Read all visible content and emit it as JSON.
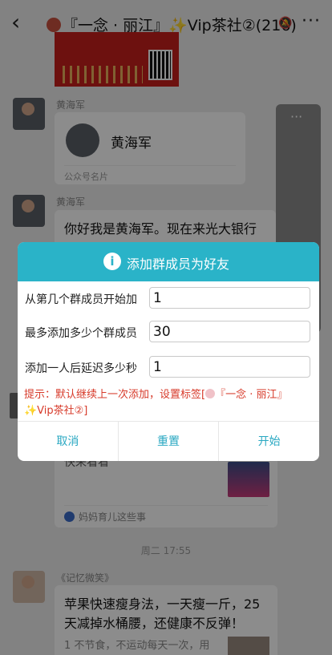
{
  "chat": {
    "back_glyph": "‹",
    "title": "『一念 · 丽江』✨Vip茶社②(216)",
    "mute_glyph": "🔕",
    "more_glyph": "···"
  },
  "messages": {
    "sender1": "黄海军",
    "card_name": "黄海军",
    "card_type": "公众号名片",
    "sender2": "黄海军",
    "bubble_text": "你好我是黄海军。现在来光大银行",
    "panel_dots": "···",
    "card2_text": "快来看看",
    "card2_source": "妈妈育儿这些事",
    "time": "周二 17:55",
    "sender3": "《记忆微笑》",
    "article_title": "苹果快速瘦身法，一天瘦一斤，25天减掉水桶腰，还健康不反弹！",
    "article_snippet": "1 不节食，不运动每天一次，用"
  },
  "dialog": {
    "icon": "i",
    "title": "添加群成员为好友",
    "fields": [
      {
        "label": "从第几个群成员开始加",
        "value": "1"
      },
      {
        "label": "最多添加多少个群成员",
        "value": "30"
      },
      {
        "label": "添加一人后延迟多少秒",
        "value": "1"
      }
    ],
    "tip_prefix": "提示：默认继续上一次添加，设置标签[",
    "tip_suffix": "『一念 · 丽江』✨Vip茶社②]",
    "buttons": {
      "cancel": "取消",
      "reset": "重置",
      "start": "开始"
    }
  },
  "colors": {
    "dialog_header": "#2ab3c8",
    "tip": "#d73a2a",
    "button_text": "#2aa8c2"
  }
}
